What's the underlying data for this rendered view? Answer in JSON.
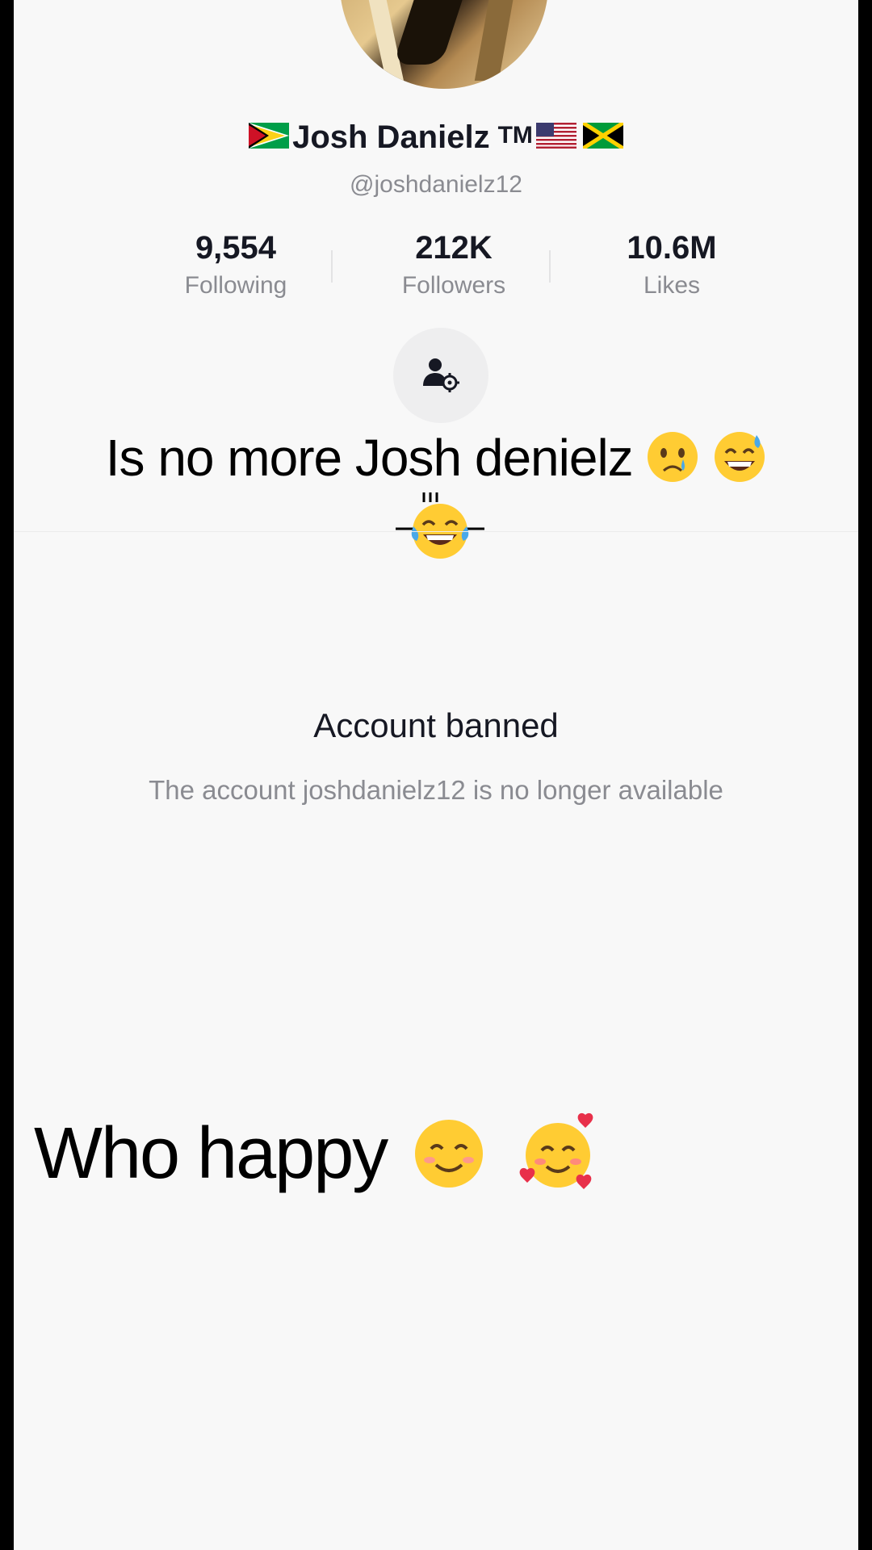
{
  "profile": {
    "display_name": "Josh Danielz",
    "trademark": "TM",
    "handle": "@joshdanielz12",
    "flags": [
      "guyana-flag",
      "usa-flag",
      "jamaica-flag"
    ]
  },
  "stats": [
    {
      "value": "9,554",
      "label": "Following"
    },
    {
      "value": "212K",
      "label": "Followers"
    },
    {
      "value": "10.6M",
      "label": "Likes"
    }
  ],
  "overlay": {
    "caption_top": "Is no more Josh denielz",
    "caption_top_emojis": [
      "crying-face-icon",
      "grinning-sweat-face-icon",
      "tears-of-joy-face-icon"
    ],
    "caption_bottom": "Who happy",
    "caption_bottom_emojis": [
      "smiling-face-icon",
      "smiling-face-with-hearts-icon"
    ]
  },
  "banned": {
    "title": "Account banned",
    "message": "The account joshdanielz12 is no longer available"
  },
  "colors": {
    "background": "#f8f8f8",
    "primary_text": "#161823",
    "secondary_text": "#8a8b91",
    "button_bg": "#eeeeef"
  }
}
